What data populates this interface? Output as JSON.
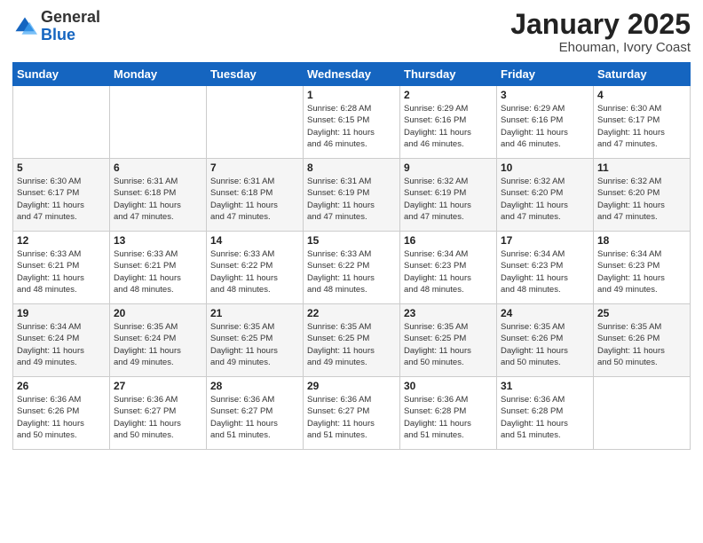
{
  "logo": {
    "general": "General",
    "blue": "Blue"
  },
  "header": {
    "month": "January 2025",
    "location": "Ehouman, Ivory Coast"
  },
  "weekdays": [
    "Sunday",
    "Monday",
    "Tuesday",
    "Wednesday",
    "Thursday",
    "Friday",
    "Saturday"
  ],
  "weeks": [
    [
      {
        "day": "",
        "info": ""
      },
      {
        "day": "",
        "info": ""
      },
      {
        "day": "",
        "info": ""
      },
      {
        "day": "1",
        "info": "Sunrise: 6:28 AM\nSunset: 6:15 PM\nDaylight: 11 hours\nand 46 minutes."
      },
      {
        "day": "2",
        "info": "Sunrise: 6:29 AM\nSunset: 6:16 PM\nDaylight: 11 hours\nand 46 minutes."
      },
      {
        "day": "3",
        "info": "Sunrise: 6:29 AM\nSunset: 6:16 PM\nDaylight: 11 hours\nand 46 minutes."
      },
      {
        "day": "4",
        "info": "Sunrise: 6:30 AM\nSunset: 6:17 PM\nDaylight: 11 hours\nand 47 minutes."
      }
    ],
    [
      {
        "day": "5",
        "info": "Sunrise: 6:30 AM\nSunset: 6:17 PM\nDaylight: 11 hours\nand 47 minutes."
      },
      {
        "day": "6",
        "info": "Sunrise: 6:31 AM\nSunset: 6:18 PM\nDaylight: 11 hours\nand 47 minutes."
      },
      {
        "day": "7",
        "info": "Sunrise: 6:31 AM\nSunset: 6:18 PM\nDaylight: 11 hours\nand 47 minutes."
      },
      {
        "day": "8",
        "info": "Sunrise: 6:31 AM\nSunset: 6:19 PM\nDaylight: 11 hours\nand 47 minutes."
      },
      {
        "day": "9",
        "info": "Sunrise: 6:32 AM\nSunset: 6:19 PM\nDaylight: 11 hours\nand 47 minutes."
      },
      {
        "day": "10",
        "info": "Sunrise: 6:32 AM\nSunset: 6:20 PM\nDaylight: 11 hours\nand 47 minutes."
      },
      {
        "day": "11",
        "info": "Sunrise: 6:32 AM\nSunset: 6:20 PM\nDaylight: 11 hours\nand 47 minutes."
      }
    ],
    [
      {
        "day": "12",
        "info": "Sunrise: 6:33 AM\nSunset: 6:21 PM\nDaylight: 11 hours\nand 48 minutes."
      },
      {
        "day": "13",
        "info": "Sunrise: 6:33 AM\nSunset: 6:21 PM\nDaylight: 11 hours\nand 48 minutes."
      },
      {
        "day": "14",
        "info": "Sunrise: 6:33 AM\nSunset: 6:22 PM\nDaylight: 11 hours\nand 48 minutes."
      },
      {
        "day": "15",
        "info": "Sunrise: 6:33 AM\nSunset: 6:22 PM\nDaylight: 11 hours\nand 48 minutes."
      },
      {
        "day": "16",
        "info": "Sunrise: 6:34 AM\nSunset: 6:23 PM\nDaylight: 11 hours\nand 48 minutes."
      },
      {
        "day": "17",
        "info": "Sunrise: 6:34 AM\nSunset: 6:23 PM\nDaylight: 11 hours\nand 48 minutes."
      },
      {
        "day": "18",
        "info": "Sunrise: 6:34 AM\nSunset: 6:23 PM\nDaylight: 11 hours\nand 49 minutes."
      }
    ],
    [
      {
        "day": "19",
        "info": "Sunrise: 6:34 AM\nSunset: 6:24 PM\nDaylight: 11 hours\nand 49 minutes."
      },
      {
        "day": "20",
        "info": "Sunrise: 6:35 AM\nSunset: 6:24 PM\nDaylight: 11 hours\nand 49 minutes."
      },
      {
        "day": "21",
        "info": "Sunrise: 6:35 AM\nSunset: 6:25 PM\nDaylight: 11 hours\nand 49 minutes."
      },
      {
        "day": "22",
        "info": "Sunrise: 6:35 AM\nSunset: 6:25 PM\nDaylight: 11 hours\nand 49 minutes."
      },
      {
        "day": "23",
        "info": "Sunrise: 6:35 AM\nSunset: 6:25 PM\nDaylight: 11 hours\nand 50 minutes."
      },
      {
        "day": "24",
        "info": "Sunrise: 6:35 AM\nSunset: 6:26 PM\nDaylight: 11 hours\nand 50 minutes."
      },
      {
        "day": "25",
        "info": "Sunrise: 6:35 AM\nSunset: 6:26 PM\nDaylight: 11 hours\nand 50 minutes."
      }
    ],
    [
      {
        "day": "26",
        "info": "Sunrise: 6:36 AM\nSunset: 6:26 PM\nDaylight: 11 hours\nand 50 minutes."
      },
      {
        "day": "27",
        "info": "Sunrise: 6:36 AM\nSunset: 6:27 PM\nDaylight: 11 hours\nand 50 minutes."
      },
      {
        "day": "28",
        "info": "Sunrise: 6:36 AM\nSunset: 6:27 PM\nDaylight: 11 hours\nand 51 minutes."
      },
      {
        "day": "29",
        "info": "Sunrise: 6:36 AM\nSunset: 6:27 PM\nDaylight: 11 hours\nand 51 minutes."
      },
      {
        "day": "30",
        "info": "Sunrise: 6:36 AM\nSunset: 6:28 PM\nDaylight: 11 hours\nand 51 minutes."
      },
      {
        "day": "31",
        "info": "Sunrise: 6:36 AM\nSunset: 6:28 PM\nDaylight: 11 hours\nand 51 minutes."
      },
      {
        "day": "",
        "info": ""
      }
    ]
  ]
}
